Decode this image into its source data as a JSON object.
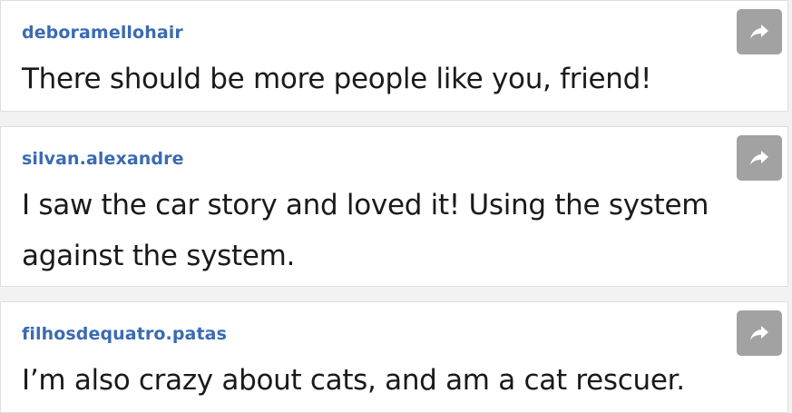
{
  "comments": [
    {
      "username": "deboramellohair",
      "text": "There should be more people like you, friend!",
      "share_icon": "share-arrow-icon"
    },
    {
      "username": "silvan.alexandre",
      "text": "I saw the car story and loved it! Using the system against the system.",
      "share_icon": "share-arrow-icon"
    },
    {
      "username": "filhosdequatro.patas",
      "text": "I’m also crazy about cats, and am a cat rescuer.",
      "share_icon": "share-arrow-icon"
    }
  ],
  "colors": {
    "username": "#3b6bb0",
    "share_button": "#a2a2a2",
    "background": "#f2f2f2"
  }
}
